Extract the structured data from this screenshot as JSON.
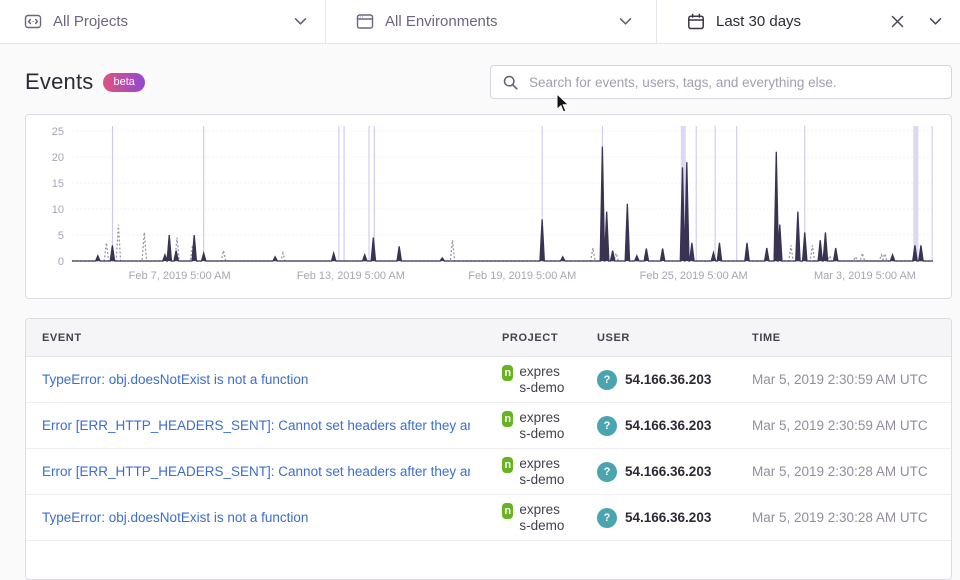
{
  "topbar": {
    "projects_label": "All Projects",
    "environments_label": "All Environments",
    "daterange_label": "Last 30 days"
  },
  "header": {
    "title": "Events",
    "badge": "beta",
    "search_placeholder": "Search for events, users, tags, and everything else."
  },
  "chart_data": {
    "type": "line",
    "title": "Events over last 30 days",
    "ylim": [
      0,
      25
    ],
    "yticks": [
      0,
      5,
      10,
      15,
      20,
      25
    ],
    "grid": true,
    "xticks": [
      {
        "frac": 0.125,
        "label": "Feb 7, 2019 5:00 AM"
      },
      {
        "frac": 0.324,
        "label": "Feb 13, 2019 5:00 AM"
      },
      {
        "frac": 0.523,
        "label": "Feb 19, 2019 5:00 AM"
      },
      {
        "frac": 0.722,
        "label": "Feb 25, 2019 5:00 AM"
      },
      {
        "frac": 0.921,
        "label": "Mar 3, 2019 5:00 AM"
      }
    ],
    "series": [
      {
        "name": "previous-period",
        "style": "dotted",
        "color": "#9d96aa",
        "spikes": [
          [
            0.04,
            3.5
          ],
          [
            0.054,
            7
          ],
          [
            0.084,
            5.5
          ],
          [
            0.122,
            4.5
          ],
          [
            0.14,
            3
          ],
          [
            0.176,
            2
          ],
          [
            0.245,
            1.5
          ],
          [
            0.442,
            4
          ],
          [
            0.605,
            2.5
          ],
          [
            0.632,
            1.5
          ],
          [
            0.835,
            3
          ],
          [
            0.86,
            3
          ],
          [
            0.88,
            1
          ],
          [
            0.91,
            0.8
          ],
          [
            0.918,
            1.5
          ],
          [
            0.94,
            1.2
          ],
          [
            0.944,
            1.4
          ]
        ]
      },
      {
        "name": "current-period",
        "style": "solid",
        "color": "#3b3353",
        "spikes": [
          [
            0.03,
            1
          ],
          [
            0.047,
            3
          ],
          [
            0.108,
            1.2
          ],
          [
            0.113,
            5
          ],
          [
            0.121,
            2
          ],
          [
            0.142,
            5
          ],
          [
            0.153,
            1.5
          ],
          [
            0.236,
            0.8
          ],
          [
            0.304,
            1.5
          ],
          [
            0.34,
            1.2
          ],
          [
            0.35,
            4.5
          ],
          [
            0.38,
            2.8
          ],
          [
            0.43,
            0.6
          ],
          [
            0.546,
            8
          ],
          [
            0.57,
            0.8
          ],
          [
            0.616,
            22
          ],
          [
            0.621,
            9.5
          ],
          [
            0.628,
            2
          ],
          [
            0.645,
            11
          ],
          [
            0.656,
            1
          ],
          [
            0.667,
            2.4
          ],
          [
            0.686,
            2.4
          ],
          [
            0.709,
            18
          ],
          [
            0.714,
            19
          ],
          [
            0.72,
            3.5
          ],
          [
            0.745,
            1.6
          ],
          [
            0.752,
            3.5
          ],
          [
            0.784,
            3.5
          ],
          [
            0.807,
            2.5
          ],
          [
            0.818,
            21
          ],
          [
            0.822,
            7
          ],
          [
            0.843,
            9.5
          ],
          [
            0.851,
            5.5
          ],
          [
            0.869,
            4
          ],
          [
            0.875,
            5.5
          ],
          [
            0.887,
            2.5
          ],
          [
            0.953,
            1.2
          ],
          [
            0.979,
            3
          ],
          [
            0.986,
            3
          ]
        ]
      }
    ],
    "releases": {
      "color": "#c9c2ef",
      "band_color": "#ddd8f4",
      "positions": [
        0.047,
        0.153,
        0.31,
        0.316,
        0.345,
        0.351,
        0.546,
        0.616,
        0.725,
        0.747,
        0.772,
        0.851,
        0.999
      ],
      "bands": [
        {
          "frac": 0.71,
          "w": 5
        },
        {
          "frac": 0.98,
          "w": 5
        }
      ]
    }
  },
  "table": {
    "columns": [
      "EVENT",
      "PROJECT",
      "USER",
      "TIME"
    ],
    "rows": [
      {
        "event": "TypeError: obj.doesNotExist is not a function",
        "project": "express-demo",
        "user": "54.166.36.203",
        "time": "Mar 5, 2019 2:30:59 AM UTC"
      },
      {
        "event": "Error [ERR_HTTP_HEADERS_SENT]: Cannot set headers after they ar…",
        "project": "express-demo",
        "user": "54.166.36.203",
        "time": "Mar 5, 2019 2:30:59 AM UTC"
      },
      {
        "event": "Error [ERR_HTTP_HEADERS_SENT]: Cannot set headers after they ar…",
        "project": "express-demo",
        "user": "54.166.36.203",
        "time": "Mar 5, 2019 2:30:28 AM UTC"
      },
      {
        "event": "TypeError: obj.doesNotExist is not a function",
        "project": "express-demo",
        "user": "54.166.36.203",
        "time": "Mar 5, 2019 2:30:28 AM UTC"
      }
    ]
  },
  "colors": {
    "link": "#3b6ecd",
    "accent_gradient_start": "#e0527e",
    "accent_gradient_end": "#9049d4",
    "node_green": "#68b322",
    "avatar_teal": "#4aa5b0"
  }
}
